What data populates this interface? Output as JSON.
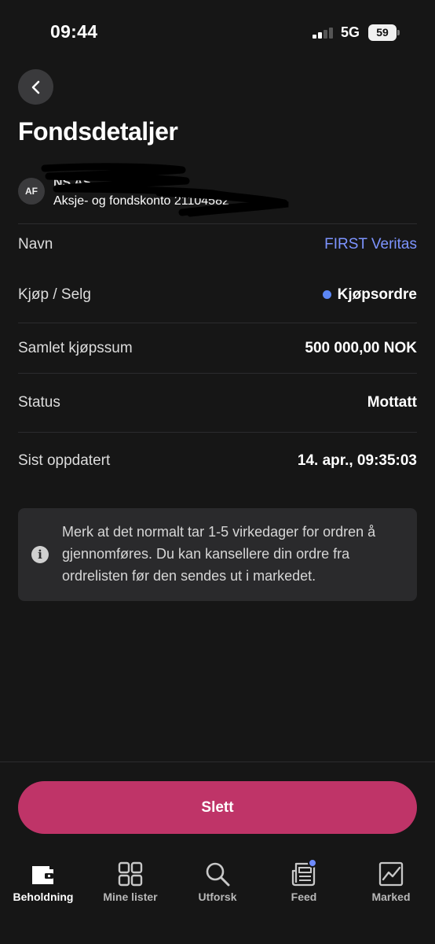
{
  "status_bar": {
    "time": "09:44",
    "network": "5G",
    "battery": "59",
    "signal_bars_active": 2,
    "signal_bars_total": 4
  },
  "header": {
    "back_icon": "chevron-left-icon",
    "title": "Fondsdetaljer"
  },
  "account": {
    "avatar_initials": "AF",
    "name": "NS AS",
    "subtitle": "Aksje- og fondskonto 21104582"
  },
  "details": [
    {
      "label": "Navn",
      "value": "FIRST Veritas",
      "style": "link"
    },
    {
      "label": "Kjøp / Selg",
      "value": "Kjøpsordre",
      "style": "dot",
      "dot_color": "#5b86f5"
    },
    {
      "label": "Samlet kjøpssum",
      "value": "500 000,00 NOK",
      "style": "bold"
    },
    {
      "label": "Status",
      "value": "Mottatt",
      "style": "bold"
    },
    {
      "label": "Sist oppdatert",
      "value": "14. apr., 09:35:03",
      "style": "bold"
    }
  ],
  "info": {
    "icon": "info-icon",
    "text": "Merk at det normalt tar 1-5 virkedager for ordren å gjennomføres. Du kan kansellere din ordre fra ordrelisten før den sendes ut i markedet."
  },
  "actions": {
    "delete_label": "Slett",
    "delete_color": "#bf3468"
  },
  "nav": {
    "items": [
      {
        "label": "Beholdning",
        "icon": "wallet-icon",
        "active": true
      },
      {
        "label": "Mine lister",
        "icon": "grid-icon",
        "active": false
      },
      {
        "label": "Utforsk",
        "icon": "search-icon",
        "active": false
      },
      {
        "label": "Feed",
        "icon": "newspaper-icon",
        "active": false,
        "badge": true
      },
      {
        "label": "Marked",
        "icon": "chart-icon",
        "active": false
      }
    ]
  },
  "colors": {
    "background": "#161616",
    "accent_link": "#7d94ff",
    "badge": "#6e8bff"
  }
}
